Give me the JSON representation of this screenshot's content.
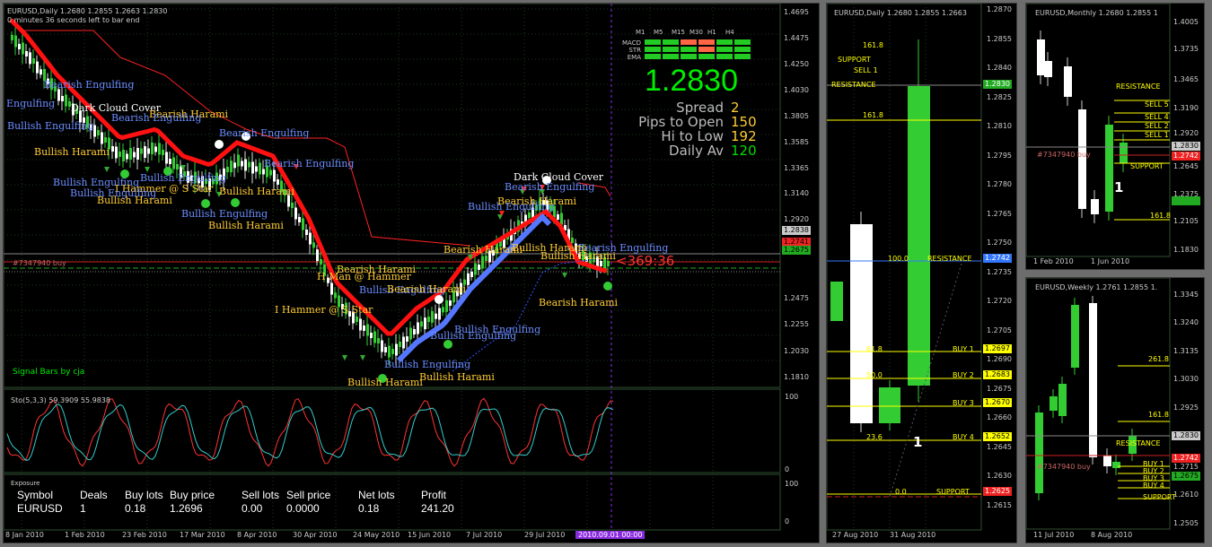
{
  "main": {
    "title": "EURUSD,Daily  1.2680 1.2855 1.2663 1.2830",
    "subtitle": "0 minutes 36 seconds left to bar end",
    "price_axis": [
      "1.4695",
      "1.4475",
      "1.4250",
      "1.4030",
      "1.3805",
      "1.3585",
      "1.3365",
      "1.3140",
      "1.2920",
      "1.2838",
      "1.2741",
      "1.2675",
      "1.2475",
      "1.2255",
      "1.2030",
      "1.1810"
    ],
    "date_axis": [
      "8 Jan 2010",
      "1 Feb 2010",
      "23 Feb 2010",
      "17 Mar 2010",
      "8 Apr 2010",
      "30 Apr 2010",
      "24 May 2010",
      "15 Jun 2010",
      "7 Jul 2010",
      "29 Jul 2010",
      "2010.09.01 00:00"
    ],
    "order_line_label": "#7347940 buy",
    "countdown": "<369:36",
    "signal_label": "Signal Bars by cja",
    "annotations": [
      {
        "text": "Engulfing",
        "color": "#6b8cff"
      },
      {
        "text": "Bearish Engulfing",
        "color": "#6b8cff"
      },
      {
        "text": "Dark Cloud Cover",
        "color": "#ffffff"
      },
      {
        "text": "Bearish Harami",
        "color": "#ffcc33"
      },
      {
        "text": "Bearish Engulfing",
        "color": "#6b8cff"
      },
      {
        "text": "Bullish Engulfing",
        "color": "#6b8cff"
      },
      {
        "text": "Bearish Engulfing",
        "color": "#6b8cff"
      },
      {
        "text": "Bullish Harami",
        "color": "#ffcc33"
      },
      {
        "text": "Bearish Engulfing",
        "color": "#6b8cff"
      },
      {
        "text": "Bullish Engulfing",
        "color": "#6b8cff"
      },
      {
        "text": "Bullish Engulfing",
        "color": "#6b8cff"
      },
      {
        "text": "I Hammer @ S Star",
        "color": "#ffcc33"
      },
      {
        "text": "Bullish Engulfing",
        "color": "#6b8cff"
      },
      {
        "text": "Bullish Harami",
        "color": "#ffcc33"
      },
      {
        "text": "Bullish Harami",
        "color": "#ffcc33"
      },
      {
        "text": "Bullish Engulfing",
        "color": "#6b8cff"
      },
      {
        "text": "Bullish Harami",
        "color": "#ffcc33"
      },
      {
        "text": "Bearish Harami",
        "color": "#ffcc33"
      },
      {
        "text": "H Man @ Hammer",
        "color": "#ffcc33"
      },
      {
        "text": "Bullish Engulfing",
        "color": "#6b8cff"
      },
      {
        "text": "Bearish Harami",
        "color": "#ffcc33"
      },
      {
        "text": "I Hammer @ S Star",
        "color": "#ffcc33"
      },
      {
        "text": "Bullish Engulfing",
        "color": "#6b8cff"
      },
      {
        "text": "Bullish Engulfing",
        "color": "#6b8cff"
      },
      {
        "text": "Bullish Harami",
        "color": "#ffcc33"
      },
      {
        "text": "Bullish Harami",
        "color": "#ffcc33"
      },
      {
        "text": "Bearish Harami",
        "color": "#ffcc33"
      },
      {
        "text": "Bearish Engulfing",
        "color": "#6b8cff"
      },
      {
        "text": "Dark Cloud Cover",
        "color": "#ffffff"
      },
      {
        "text": "Bearish Engulfing",
        "color": "#6b8cff"
      },
      {
        "text": "Bearish Harami",
        "color": "#ffcc33"
      },
      {
        "text": "Bullish Engulfing",
        "color": "#6b8cff"
      },
      {
        "text": "Bullish Harami",
        "color": "#ffcc33"
      },
      {
        "text": "Bearish Harami",
        "color": "#ffcc33"
      },
      {
        "text": "Bullish Harami",
        "color": "#ffcc33"
      },
      {
        "text": "Bullish Engulfing",
        "color": "#6b8cff"
      }
    ],
    "dashboard": {
      "timeframes": [
        "M1",
        "M5",
        "M15",
        "M30",
        "H1",
        "H4"
      ],
      "rows": [
        "MACD",
        "STR",
        "EMA"
      ],
      "big_price": "1.2830",
      "stats": [
        {
          "label": "Spread",
          "value": "2"
        },
        {
          "label": "Pips to Open",
          "value": "150"
        },
        {
          "label": "Hi to Low",
          "value": "192"
        },
        {
          "label": "Daily Av",
          "value": "120"
        }
      ]
    }
  },
  "stochastic": {
    "title": "Sto(5,3,3) 59.3909 55.9838",
    "axis": [
      "100",
      "0"
    ]
  },
  "exposure": {
    "title": "Exposure",
    "headers": [
      "Symbol",
      "Deals",
      "Buy lots",
      "Buy price",
      "Sell lots",
      "Sell price",
      "Net lots",
      "Profit"
    ],
    "row": [
      "EURUSD",
      "1",
      "0.18",
      "1.2696",
      "0.00",
      "0.0000",
      "0.18",
      "241.20"
    ],
    "axis": [
      "100",
      "0"
    ]
  },
  "daily_zoom": {
    "title": "EURUSD,Daily  1.2680 1.2855 1.2663",
    "price_axis": [
      "1.2870",
      "1.2855",
      "1.2840",
      "1.2825",
      "1.2810",
      "1.2795",
      "1.2780",
      "1.2765",
      "1.2750",
      "1.2735",
      "1.2720",
      "1.2705",
      "1.2690",
      "1.2675",
      "1.2660",
      "1.2645",
      "1.2630",
      "1.2615"
    ],
    "date_axis": [
      "27 Aug 2010",
      "31 Aug 2010"
    ],
    "levels": [
      {
        "text": "161.8",
        "box": "",
        "color": "#ffff00"
      },
      {
        "text": "SUPPORT",
        "box": "",
        "color": "#ffff00"
      },
      {
        "text": "SELL 1",
        "box": "",
        "color": "#ffff00"
      },
      {
        "text": "RESISTANCE",
        "box": "1.2830",
        "color": "#ffff00"
      },
      {
        "text": "161.8",
        "box": "",
        "color": "#ffff00"
      },
      {
        "text": "100.0",
        "box": "1.2742",
        "color": "#ffff00"
      },
      {
        "text": "RESISTANCE",
        "box": "",
        "color": "#ffff00"
      },
      {
        "text": "61.8",
        "box": "1.2697",
        "color": "#ffff00"
      },
      {
        "text": "BUY 1",
        "box": "",
        "color": "#ffff00"
      },
      {
        "text": "50.0",
        "box": "1.2683",
        "color": "#ffff00"
      },
      {
        "text": "BUY 2",
        "box": "",
        "color": "#ffff00"
      },
      {
        "text": "BUY 3",
        "box": "1.2670",
        "color": "#ffff00"
      },
      {
        "text": "23.6",
        "box": "1.2652",
        "color": "#ffff00"
      },
      {
        "text": "BUY 4",
        "box": "",
        "color": "#ffff00"
      },
      {
        "text": "0.0",
        "box": "1.2625",
        "color": "#ffff00"
      },
      {
        "text": "SUPPORT",
        "box": "",
        "color": "#ffff00"
      }
    ],
    "level_count_label": "1"
  },
  "monthly": {
    "title": "EURUSD,Monthly  1.2680 1.2855 1",
    "price_axis": [
      "1.4005",
      "1.3735",
      "1.3465",
      "1.3190",
      "1.2920",
      "1.2830",
      "1.2742",
      "1.2645",
      "1.2375",
      "1.2105",
      "1.1830"
    ],
    "date_axis": [
      "1 Feb 2010",
      "1 Jun 2010"
    ],
    "labels": [
      "RESISTANCE",
      "SELL 5",
      "SELL 4",
      "SELL 2",
      "SELL 1",
      "SUPPORT",
      "161.8",
      "#7347940 buy"
    ],
    "count_label": "1"
  },
  "weekly": {
    "title": "EURUSD,Weekly  1.2761 1.2855 1.",
    "price_axis": [
      "1.3345",
      "1.3240",
      "1.3135",
      "1.3030",
      "1.2925",
      "1.2830",
      "1.2742",
      "1.2715",
      "1.2675",
      "1.2610",
      "1.2505"
    ],
    "date_axis": [
      "11 Jul 2010",
      "8 Aug 2010"
    ],
    "labels": [
      "261.8",
      "161.8",
      "RESISTANCE",
      "BUY 1",
      "BUY 2",
      "BUY 3",
      "BUY 4",
      "SUPPORT",
      "#7347940 buy"
    ]
  },
  "colors": {
    "bull": "#33cc33",
    "bear": "#ffffff",
    "red_stop": "#ff1111",
    "blue_stop": "#5577ff",
    "yellow": "#ffff00",
    "grid": "#1e3a1e",
    "green_text": "#00ee00"
  }
}
